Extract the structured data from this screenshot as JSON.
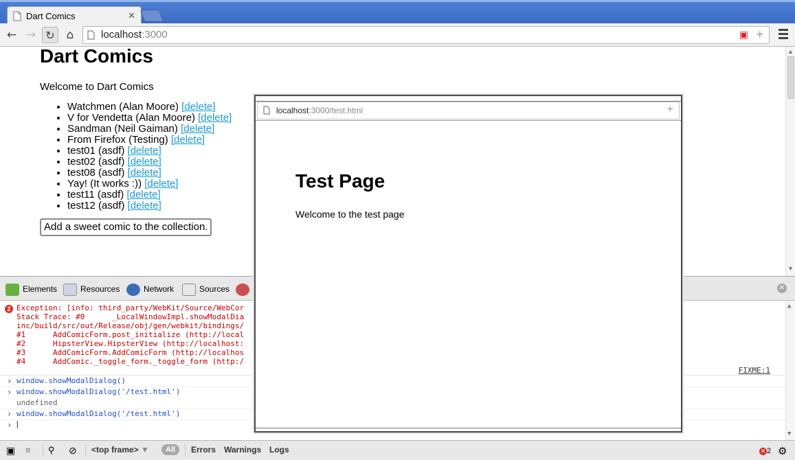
{
  "browser": {
    "tab_title": "Dart Comics",
    "tab_close": "✕",
    "url_host": "localhost",
    "url_port": ":3000"
  },
  "page": {
    "title": "Dart Comics",
    "welcome": "Welcome to Dart Comics",
    "delete_label": "[delete]",
    "comics": [
      {
        "text": "Watchmen (Alan Moore)"
      },
      {
        "text": "V for Vendetta (Alan Moore)"
      },
      {
        "text": "Sandman (Neil Gaiman)"
      },
      {
        "text": "From Firefox (Testing)"
      },
      {
        "text": "test01 (asdf)"
      },
      {
        "text": "test02 (asdf)"
      },
      {
        "text": "test08 (asdf)"
      },
      {
        "text": "Yay! (It works :))"
      },
      {
        "text": "test11 (asdf)"
      },
      {
        "text": "test12 (asdf)"
      }
    ],
    "add_button": "Add a sweet comic to the collection."
  },
  "modal": {
    "url_host": "localhost",
    "url_path": ":3000/test.html",
    "title": "Test Page",
    "welcome": "Welcome to the test page"
  },
  "devtools": {
    "tabs": [
      "Elements",
      "Resources",
      "Network",
      "Sources"
    ],
    "error_count": "2",
    "error_lines": [
      "Exception: [info: third_party/WebKit/Source/WebCor",
      "Stack Trace: #0      _LocalWindowImpl.showModalDia",
      "inc/build/src/out/Release/obj/gen/webkit/bindings/",
      "#1      AddComicForm.post_initialize (http://local",
      "#2      HipsterView.HipsterView (http://localhost:",
      "#3      AddComicForm.AddComicForm (http://localhos",
      "#4      AddComic._toggle_form._toggle_form (http:/"
    ],
    "fixme_link": "FIXME:1",
    "console_lines": [
      {
        "type": "cmd",
        "text": "window.showModalDialog()"
      },
      {
        "type": "cmd",
        "text": "window.showModalDialog('/test.html')"
      },
      {
        "type": "res",
        "text": "undefined"
      },
      {
        "type": "cmd",
        "text": "window.showModalDialog('/test.html')"
      }
    ],
    "status": {
      "frame": "<top frame>",
      "all": "All",
      "errors": "Errors",
      "warnings": "Warnings",
      "logs": "Logs",
      "error_badge": "2"
    }
  }
}
